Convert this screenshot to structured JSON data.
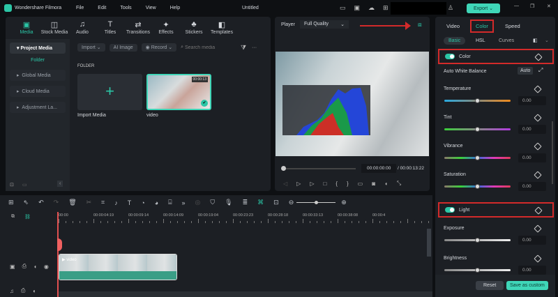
{
  "app": {
    "name": "Wondershare Filmora",
    "title": "Untitled",
    "menu": [
      "File",
      "Edit",
      "Tools",
      "View",
      "Help"
    ],
    "export_label": "Export"
  },
  "media_tabs": [
    {
      "label": "Media",
      "icon": "media-icon",
      "glyph": "▣"
    },
    {
      "label": "Stock Media",
      "icon": "stock-media-icon",
      "glyph": "◫"
    },
    {
      "label": "Audio",
      "icon": "audio-icon",
      "glyph": "♫"
    },
    {
      "label": "Titles",
      "icon": "titles-icon",
      "glyph": "T"
    },
    {
      "label": "Transitions",
      "icon": "transitions-icon",
      "glyph": "⇄"
    },
    {
      "label": "Effects",
      "icon": "effects-icon",
      "glyph": "✦"
    },
    {
      "label": "Stickers",
      "icon": "stickers-icon",
      "glyph": "♣"
    },
    {
      "label": "Templates",
      "icon": "templates-icon",
      "glyph": "◧"
    }
  ],
  "sidebar": {
    "project_media": "Project Media",
    "folder": "Folder",
    "items": [
      "Global Media",
      "Cloud Media",
      "Adjustment La..."
    ]
  },
  "media_toolbar": {
    "import": "Import",
    "ai_image": "AI Image",
    "record": "Record",
    "search_placeholder": "Search media"
  },
  "library": {
    "folder_heading": "FOLDER",
    "import_label": "Import Media",
    "clip_name": "video",
    "clip_duration": "00:00:13"
  },
  "player": {
    "label": "Player",
    "quality": "Full Quality",
    "current_time": "00:00:00:00",
    "total_time": "/ 00:00:13:22"
  },
  "inspector": {
    "tabs": [
      "Video",
      "Color",
      "Speed"
    ],
    "active_tab": "Color",
    "subtabs": [
      "Basic",
      "HSL",
      "Curves"
    ],
    "color_section": "Color",
    "auto_white_balance": "Auto White Balance",
    "auto_label": "Auto",
    "color_sliders": [
      {
        "label": "Temperature",
        "value": "0.00",
        "gradient": "linear-gradient(90deg,#29a9e0,#8a8a7a,#f08a1c)"
      },
      {
        "label": "Tint",
        "value": "0.00",
        "gradient": "linear-gradient(90deg,#3ad13a,#888,#b23ae0)"
      },
      {
        "label": "Vibrance",
        "value": "0.00",
        "gradient": "linear-gradient(90deg,#8a7a6a,#3ad13a,#3a6ae0,#e03ab8,#e03a5a)"
      },
      {
        "label": "Saturation",
        "value": "0.00",
        "gradient": "linear-gradient(90deg,#8a7a6a,#3ad13a,#3a6ae0,#e03ab8,#e03a5a)"
      }
    ],
    "light_section": "Light",
    "light_sliders": [
      {
        "label": "Exposure",
        "value": "0.00"
      },
      {
        "label": "Brightness",
        "value": "0.00"
      }
    ],
    "reset": "Reset",
    "save_custom": "Save as custom"
  },
  "timeline": {
    "ruler": [
      "00:00",
      "00:00:04:19",
      "00:00:09:14",
      "00:00:14:09",
      "00:00:19:04",
      "00:00:23:23",
      "00:00:28:18",
      "00:00:33:13",
      "00:00:38:08",
      "00:00:4"
    ],
    "clip_label": "video"
  },
  "colors": {
    "accent": "#2bc6a6",
    "highlight": "#d32a2a"
  }
}
